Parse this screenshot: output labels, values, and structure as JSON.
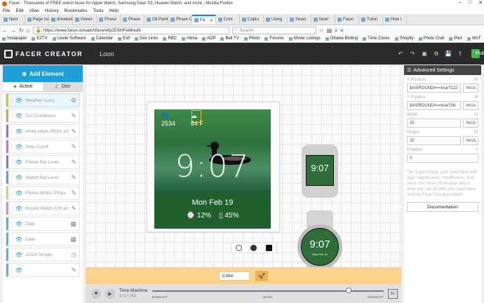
{
  "window": {
    "title": "Facer - Thousands of FREE watch faces for Apple Watch, Samsung Gear S3, Huawei Watch, and more - Mozilla Firefox"
  },
  "menu": [
    "File",
    "Edit",
    "View",
    "History",
    "Bookmarks",
    "Tools",
    "Help"
  ],
  "tabs": [
    {
      "label": "Nest",
      "active": false
    },
    {
      "label": "Page not",
      "active": false
    },
    {
      "label": "drivetest",
      "active": false
    },
    {
      "label": "Green",
      "active": false
    },
    {
      "label": "Phase",
      "active": false
    },
    {
      "label": "Phase",
      "active": false
    },
    {
      "label": "Oil Paintin",
      "active": false
    },
    {
      "label": "Phase One",
      "active": false
    },
    {
      "label": "Fa",
      "active": true
    },
    {
      "label": "Com",
      "active": false
    },
    {
      "label": "Captu",
      "active": false
    },
    {
      "label": "Using",
      "active": false
    },
    {
      "label": "Searc",
      "active": false
    },
    {
      "label": "facer",
      "active": false
    },
    {
      "label": "Facer",
      "active": false
    },
    {
      "label": "Tutori",
      "active": false
    },
    {
      "label": "How t",
      "active": false
    }
  ],
  "nav": {
    "url": "https://www.facer.io/watchface/efp2E6HFeM/edit",
    "search_placeholder": "Search"
  },
  "bookmarks": [
    "Instapaper",
    "EZTV",
    "Leslie Software",
    "Calendar",
    "Exif",
    "Dev Links",
    "RBC",
    "mbna",
    "ADP",
    "Bell TV",
    "Photo",
    "Forums",
    "Movie Listings",
    "Ottawa Birding",
    "Time Zones",
    "Shopify",
    "Photo Club",
    "Plex",
    "WoT",
    "Router"
  ],
  "app": {
    "logo": "FACER CREATOR",
    "face_name": "Loon",
    "publish_label": "Publish",
    "add_element_label": "Add Element",
    "mode_active": "Active",
    "mode_dim": "Dim",
    "layers": [
      {
        "label": "Weather Icons",
        "icon": "gear-icon",
        "color": "#f2c200",
        "selected": true
      },
      {
        "label": "Cur Conditions",
        "icon": "pencil-icon",
        "color": "#e6a23c",
        "selected": false
      },
      {
        "label": "white-steps-300px.pn",
        "icon": "pencil-icon",
        "color": "#9c6ade",
        "selected": false
      },
      {
        "label": "Step Count",
        "icon": "pencil-icon",
        "color": "#d96bd9",
        "selected": false
      },
      {
        "label": "Phone Bat Level",
        "icon": "pencil-icon",
        "color": "#6f7ed9",
        "selected": false
      },
      {
        "label": "Watch Bat Level",
        "icon": "pencil-icon",
        "color": "#5aa0e0",
        "selected": false
      },
      {
        "label": "Phone-White-300px.",
        "icon": "pencil-icon",
        "color": "#c8df5a",
        "selected": false
      },
      {
        "label": "Round-Watch-100.pn",
        "icon": "pencil-icon",
        "color": "#d08ad9",
        "selected": false
      },
      {
        "label": "Date",
        "icon": "calendar-icon",
        "color": "#5ab0e0",
        "selected": false
      },
      {
        "label": "Date",
        "icon": "calendar-icon",
        "color": "#5ab0e0",
        "selected": false
      },
      {
        "label": "12/24 Simple",
        "icon": "clock-icon",
        "color": "#5ab0e0",
        "selected": false
      },
      {
        "label": ":",
        "icon": "pencil-icon",
        "color": "#5ab0e0",
        "selected": false
      }
    ],
    "watch": {
      "steps": "2534",
      "temp": "84 F",
      "time": "9:07",
      "date": "Mon Feb 19",
      "battery_watch": "12%",
      "battery_phone": "45%",
      "mini_date": "Mon Feb 19"
    },
    "advanced": {
      "title": "Advanced Settings",
      "x_label": "X Position",
      "x_value": "$#ISROUND#==true?122",
      "x_hint": "90",
      "y_label": "Y Position",
      "y_value": "$#ISROUND#==true?36:",
      "y_hint": "36",
      "w_label": "Width",
      "w_value": "20",
      "w_hint": "20",
      "h_label": "Height",
      "h_value": "20",
      "h_hint": "20",
      "r_label": "Rotation",
      "r_value": "0",
      "r_hint": "0",
      "tags_label": "TAGS",
      "tip": "Tip: Supercharge your watchface with tags, expressions, conditionals, and more. For more information about what you can do with your watchface, visit the Facer Documentation.",
      "doc_button": "Documentation"
    },
    "color_label": "Color",
    "time_machine": {
      "label": "Time Machine",
      "value": "9:07 PM",
      "left": "MIDNIGHT",
      "mid": "NOON",
      "right": "MIDNIGHT",
      "cal": "31"
    }
  }
}
